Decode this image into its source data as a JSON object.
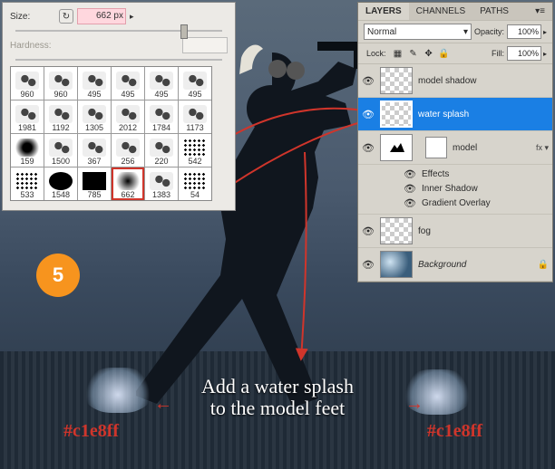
{
  "step_number": "5",
  "caption_line1": "Add a water splash",
  "caption_line2": "to the model feet",
  "hex_left": "#c1e8ff",
  "hex_right": "#c1e8ff",
  "brush_panel": {
    "size_label": "Size:",
    "size_value": "662 px",
    "hardness_label": "Hardness:",
    "brushes": [
      {
        "n": "960"
      },
      {
        "n": "960"
      },
      {
        "n": "495"
      },
      {
        "n": "495"
      },
      {
        "n": "495"
      },
      {
        "n": "495"
      },
      {
        "n": "1981"
      },
      {
        "n": "1192"
      },
      {
        "n": "1305"
      },
      {
        "n": "2012"
      },
      {
        "n": "1784"
      },
      {
        "n": "1173"
      },
      {
        "n": "159"
      },
      {
        "n": "1500"
      },
      {
        "n": "367"
      },
      {
        "n": "256"
      },
      {
        "n": "220"
      },
      {
        "n": "542"
      },
      {
        "n": "533"
      },
      {
        "n": "1548"
      },
      {
        "n": "785"
      },
      {
        "n": "662",
        "sel": true
      },
      {
        "n": "1383"
      },
      {
        "n": "54"
      }
    ]
  },
  "layers_panel": {
    "tab_layers": "LAYERS",
    "tab_channels": "CHANNELS",
    "tab_paths": "PATHS",
    "blend_mode": "Normal",
    "opacity_label": "Opacity:",
    "opacity_value": "100%",
    "lock_label": "Lock:",
    "fill_label": "Fill:",
    "fill_value": "100%",
    "layers": [
      {
        "name": "model shadow",
        "thumb": "checker"
      },
      {
        "name": "water splash",
        "thumb": "checker",
        "selected": true
      },
      {
        "name": "model",
        "thumb": "mask",
        "fx": true
      },
      {
        "name": "fog",
        "thumb": "checker"
      },
      {
        "name": "Background",
        "thumb": "bg",
        "locked": true
      }
    ],
    "effects_label": "Effects",
    "effect_inner": "Inner Shadow",
    "effect_grad": "Gradient Overlay"
  }
}
